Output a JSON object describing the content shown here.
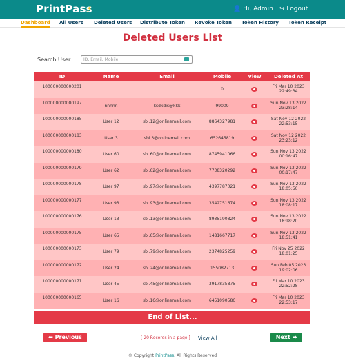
{
  "header": {
    "brand": "PrintPass",
    "user_label": "Hi, Admin",
    "logout_label": "Logout"
  },
  "tabs": [
    {
      "label": "Dashboard",
      "active": true
    },
    {
      "label": "All Users"
    },
    {
      "label": "Deleted Users"
    },
    {
      "label": "Distribute Token"
    },
    {
      "label": "Revoke Token"
    },
    {
      "label": "Token History"
    },
    {
      "label": "Token Receipt"
    }
  ],
  "page_title": "Deleted Users List",
  "search": {
    "label": "Search User",
    "placeholder": "ID, Email, Mobile",
    "value": ""
  },
  "table": {
    "columns": [
      "ID",
      "Name",
      "Email",
      "Mobile",
      "View",
      "Deleted At"
    ],
    "rows": [
      {
        "id": "100000000000201",
        "name": "",
        "email": "",
        "mobile": "0",
        "date": "Fri Mar 10 2023",
        "time": "22:49:34"
      },
      {
        "id": "100000000000197",
        "name": "nnnnn",
        "email": "ksdkdis@kkk",
        "mobile": "99009",
        "date": "Sun Nov 13 2022",
        "time": "23:28:14"
      },
      {
        "id": "100000000000185",
        "name": "User 12",
        "email": "sbi.12@onlinemail.com",
        "mobile": "8864327981",
        "date": "Sat Nov 12 2022",
        "time": "22:53:15"
      },
      {
        "id": "100000000000183",
        "name": "User 3",
        "email": "sbi.3@onlinemail.com",
        "mobile": "652645819",
        "date": "Sat Nov 12 2022",
        "time": "23:23:12"
      },
      {
        "id": "100000000000180",
        "name": "User 60",
        "email": "sbi.60@onlinemail.com",
        "mobile": "8745941066",
        "date": "Sun Nov 13 2022",
        "time": "00:16:47"
      },
      {
        "id": "100000000000179",
        "name": "User 62",
        "email": "sbi.62@onlinemail.com",
        "mobile": "7738320292",
        "date": "Sun Nov 13 2022",
        "time": "00:17:47"
      },
      {
        "id": "100000000000178",
        "name": "User 97",
        "email": "sbi.97@onlinemail.com",
        "mobile": "4397787021",
        "date": "Sun Nov 13 2022",
        "time": "18:05:50"
      },
      {
        "id": "100000000000177",
        "name": "User 93",
        "email": "sbi.93@onlinemail.com",
        "mobile": "3542751674",
        "date": "Sun Nov 13 2022",
        "time": "18:08:17"
      },
      {
        "id": "100000000000176",
        "name": "User 13",
        "email": "sbi.13@onlinemail.com",
        "mobile": "8935190824",
        "date": "Sun Nov 13 2022",
        "time": "18:18:20"
      },
      {
        "id": "100000000000175",
        "name": "User 65",
        "email": "sbi.65@onlinemail.com",
        "mobile": "1481667717",
        "date": "Sun Nov 13 2022",
        "time": "18:51:41"
      },
      {
        "id": "100000000000173",
        "name": "User 79",
        "email": "sbi.79@onlinemail.com",
        "mobile": "2374825259",
        "date": "Fri Nov 25 2022",
        "time": "18:01:25"
      },
      {
        "id": "100000000000172",
        "name": "User 24",
        "email": "sbi.24@onlinemail.com",
        "mobile": "155082713",
        "date": "Sun Feb 05 2023",
        "time": "19:02:06"
      },
      {
        "id": "100000000000171",
        "name": "User 45",
        "email": "sbi.45@onlinemail.com",
        "mobile": "3917835875",
        "date": "Fri Mar 10 2023",
        "time": "22:52:28"
      },
      {
        "id": "100000000000165",
        "name": "User 16",
        "email": "sbi.16@onlinemail.com",
        "mobile": "6451090586",
        "date": "Fri Mar 10 2023",
        "time": "22:53:17"
      }
    ],
    "end_label": "End of List..."
  },
  "pagination": {
    "prev_label": "Previous",
    "next_label": "Next",
    "records_text": "[ 20 Records in a page ]",
    "view_all_label": "View All"
  },
  "footer": {
    "copyright_prefix": "© Copyright ",
    "brand": "PrintPass",
    "suffix": ". All Rights Reserved"
  },
  "colors": {
    "topbar": "#0b8a8a",
    "accent_red": "#e43a47",
    "row_light": "#ffc6c6",
    "row_dark": "#ffb1b3",
    "next_green": "#1a8a4a",
    "tab_active": "#f0a500"
  }
}
